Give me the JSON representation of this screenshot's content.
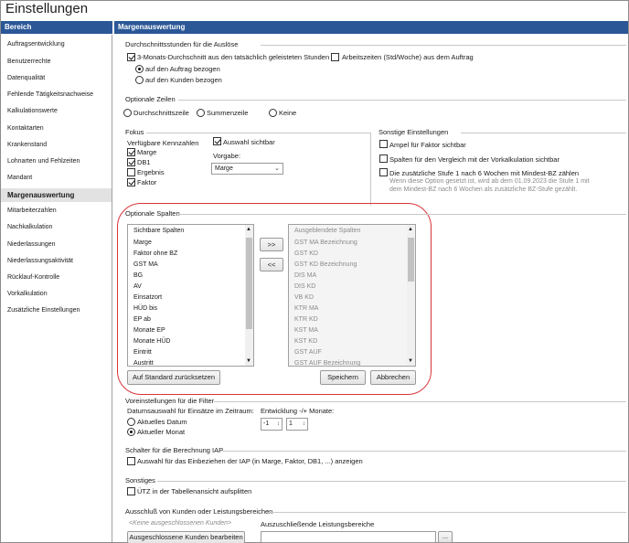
{
  "window": {
    "title": "Einstellungen"
  },
  "sidebar": {
    "header": "Bereich",
    "items": [
      {
        "label": "Auftragsentwicklung"
      },
      {
        "label": "Benutzerrechte"
      },
      {
        "label": "Datenqualität"
      },
      {
        "label": "Fehlende Tätigkeitsnachweise"
      },
      {
        "label": "Kalkulationswerte"
      },
      {
        "label": "Kontaktarten"
      },
      {
        "label": "Krankenstand"
      },
      {
        "label": "Lohnarten und Fehlzeiten"
      },
      {
        "label": "Mandant"
      },
      {
        "label": "Margenauswertung",
        "active": true
      },
      {
        "label": "Mitarbeiterzahlen"
      },
      {
        "label": "Nachkalkulation"
      },
      {
        "label": "Niederlassungen"
      },
      {
        "label": "Niederlassungsaktivität"
      },
      {
        "label": "Rücklauf-Kontrolle"
      },
      {
        "label": "Vorkalkulation"
      },
      {
        "label": "Zusätzliche Einstellungen"
      }
    ]
  },
  "main": {
    "header": "Margenauswertung",
    "durchschnitt": {
      "label": "Durchschnittsstunden für die Auslöse",
      "cb1": "3-Monats-Durchschnitt aus den tatsächlich geleisteten Stunden",
      "cb2": "Arbeitszeiten (Std/Woche) aus dem Auftrag",
      "r1": "auf den Auftrag bezogen",
      "r2": "auf den Kunden bezogen"
    },
    "optionale_zeilen": {
      "label": "Optionale Zeilen",
      "options": [
        "Durchschnittszeile",
        "Summenzeile",
        "Keine"
      ]
    },
    "fokus": {
      "label": "Fokus",
      "kennzahlen_label": "Verfügbare Kennzahlen",
      "items": [
        {
          "label": "Marge",
          "checked": true
        },
        {
          "label": "DB1",
          "checked": true
        },
        {
          "label": "Ergebnis",
          "checked": false
        },
        {
          "label": "Faktor",
          "checked": true
        }
      ],
      "auswahl_sichtbar": "Auswahl sichtbar",
      "vorgabe_label": "Vorgabe:",
      "vorgabe_value": "Marge"
    },
    "sonstige_einstellungen": {
      "label": "Sonstige Einstellungen",
      "cb1": "Ampel für Faktor sichtbar",
      "cb2": "Spalten für den Vergleich mit der Vorkalkulation sichtbar",
      "cb3": "Die zusätzliche Stufe 1 nach 6 Wochen mit Mindest-BZ zählen",
      "note1": "Wenn diese Option gesetzt ist, wird ab dem 01.09.2023 die Stufe 1 mit",
      "note2": "dem Mindest-BZ nach 6 Wochen als zusätzliche BZ-Stufe gezählt."
    },
    "optionale_spalten": {
      "label": "Optionale Spalten",
      "visible_header": "Sichtbare Spalten",
      "visible": [
        "Marge",
        "Faktor ohne BZ",
        "GST MA",
        "BG",
        "AV",
        "Einsatzort",
        "HÜD bis",
        "EP ab",
        "Monate EP",
        "Monate HÜD",
        "Eintritt",
        "Austritt"
      ],
      "hidden_header": "Ausgeblendete Spalten",
      "hidden": [
        "GST MA Bezeichnung",
        "GST KD",
        "GST KD Bezeichnung",
        "DIS MA",
        "DIS KD",
        "VB KD",
        "KTR MA",
        "KTR KD",
        "KST MA",
        "KST KD",
        "GST AUF",
        "GST AUF Bezeichnung"
      ],
      "move_right": ">>",
      "move_left": "<<",
      "reset": "Auf Standard zurücksetzen",
      "save": "Speichern",
      "cancel": "Abbrechen"
    },
    "filter": {
      "label": "Voreinstellungen für die Filter",
      "datum_label": "Datumsauswahl für Einsätze im Zeitraum:",
      "r1": "Aktuelles Datum",
      "r2": "Aktueller Monat",
      "entwicklung_label": "Entwicklung -/+ Monate:",
      "minus_value": "-1",
      "plus_value": "1"
    },
    "iap": {
      "label": "Schalter für die Berechnung IAP",
      "cb": "Auswahl für das Einbeziehen der IAP (in Marge, Faktor, DB1, ...) anzeigen"
    },
    "sonstiges": {
      "label": "Sonstiges",
      "cb": "ÜTZ in der Tabellenansicht aufsplitten"
    },
    "ausschluss": {
      "label": "Ausschluß von Kunden oder Leistungsbereichen",
      "kunden_placeholder": "<Keine ausgeschlossenen Kunden>",
      "kunden_button": "Ausgeschlossene Kunden bearbeiten",
      "leistungsbereiche_label": "Auszuschließende Leistungsbereiche",
      "dots": "..."
    }
  }
}
